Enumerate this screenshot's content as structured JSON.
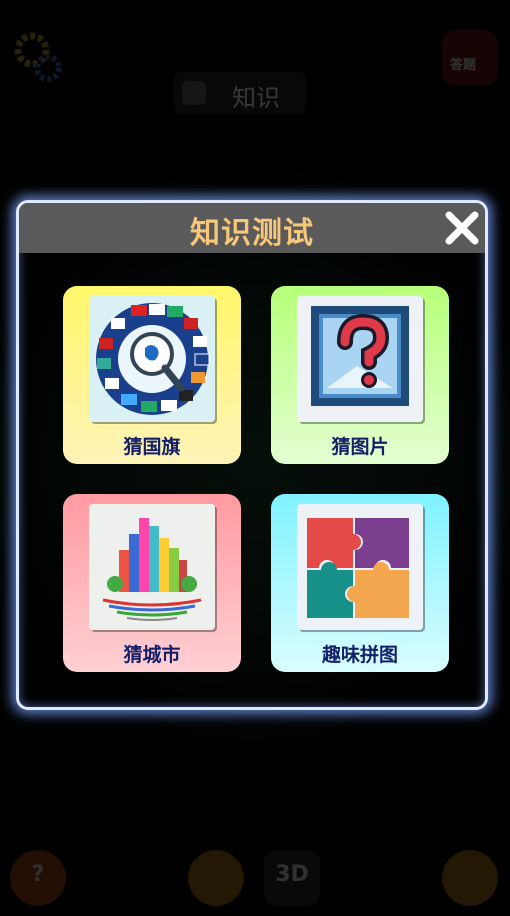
{
  "background": {
    "top_tab_label": "知识",
    "bag_label": "答题",
    "cube_label": "3D",
    "help_label": "?"
  },
  "dialog": {
    "title": "知识测试",
    "close_icon": "close-x-icon",
    "cards": [
      {
        "label": "猜国旗",
        "icon": "flag-globe-icon",
        "color": "#fff76a"
      },
      {
        "label": "猜图片",
        "icon": "question-picture-icon",
        "color": "#b6ff78"
      },
      {
        "label": "猜城市",
        "icon": "city-skyline-icon",
        "color": "#ff9aa0"
      },
      {
        "label": "趣味拼图",
        "icon": "puzzle-icon",
        "color": "#7ff2ff"
      }
    ]
  },
  "colors": {
    "title_text": "#f7c77a",
    "label_text": "#14206a",
    "dialog_border": "#dfe8ff"
  }
}
